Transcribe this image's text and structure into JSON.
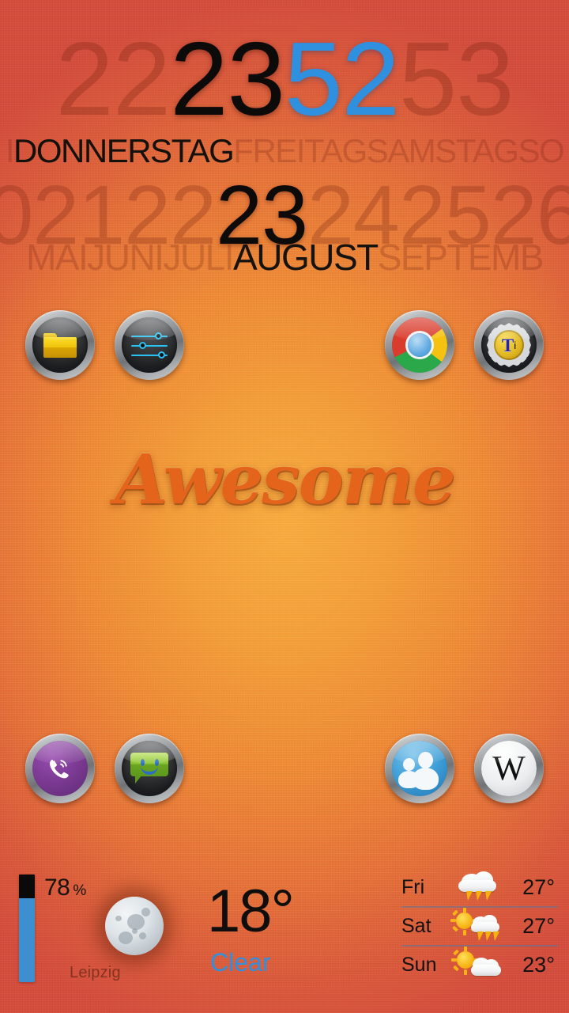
{
  "wallpaper": {
    "center_color": "#f7ad42",
    "edge_color": "#d4503f"
  },
  "clock_widget": {
    "hours": {
      "previous": "22",
      "current": "23",
      "current_color": "#0d0b09"
    },
    "minutes": {
      "current": "52",
      "next": "53",
      "current_color": "#2f90e0"
    },
    "weekdays": {
      "before": "I",
      "current": "DONNERSTAG",
      "after": [
        "FREITAG",
        "SAMSTAG",
        "SO"
      ]
    },
    "days": {
      "before": [
        "0",
        "21",
        "22"
      ],
      "current": "23",
      "after": [
        "24",
        "25",
        "26"
      ]
    },
    "months": {
      "before": [
        "MAI",
        "JUNI",
        "JULI"
      ],
      "current": "AUGUST",
      "after": [
        "SEPTEMB"
      ]
    }
  },
  "branding": {
    "text": "Awesome",
    "color": "#e4641b"
  },
  "icons": {
    "top_left": [
      {
        "name": "file-manager",
        "glyph": "folder-icon",
        "label": "File Manager"
      },
      {
        "name": "settings",
        "glyph": "sliders-icon",
        "label": "Settings"
      }
    ],
    "top_right": [
      {
        "name": "chrome",
        "glyph": "chrome-icon",
        "label": "Chrome"
      },
      {
        "name": "titanium-backup",
        "glyph": "titanium-icon",
        "label": "Titanium Backup",
        "mark": "T",
        "mark_sub": "i"
      }
    ],
    "bottom_left": [
      {
        "name": "viber",
        "glyph": "phone-icon",
        "label": "Viber"
      },
      {
        "name": "messaging",
        "glyph": "sms-bubble-icon",
        "label": "Messaging"
      }
    ],
    "bottom_right": [
      {
        "name": "contacts",
        "glyph": "people-icon",
        "label": "Contacts"
      },
      {
        "name": "wikipedia",
        "glyph": "wikipedia-icon",
        "label": "Wikipedia",
        "mark": "W"
      }
    ]
  },
  "status": {
    "battery_percent": 78,
    "battery_text": "78",
    "battery_unit": "%",
    "battery_fill_color": "#3d8fd0",
    "battery_empty_color": "#0a0a0a",
    "city": "Leipzig",
    "moon_phase": "full-moon"
  },
  "weather": {
    "temperature": "18°",
    "condition": "Clear",
    "condition_color": "#2f90e0",
    "forecast": [
      {
        "day": "Fri",
        "icon": "thunderstorm-icon",
        "temp": "27°"
      },
      {
        "day": "Sat",
        "icon": "sun-thunderstorm-icon",
        "temp": "27°"
      },
      {
        "day": "Sun",
        "icon": "sun-cloud-icon",
        "temp": "23°"
      }
    ]
  }
}
